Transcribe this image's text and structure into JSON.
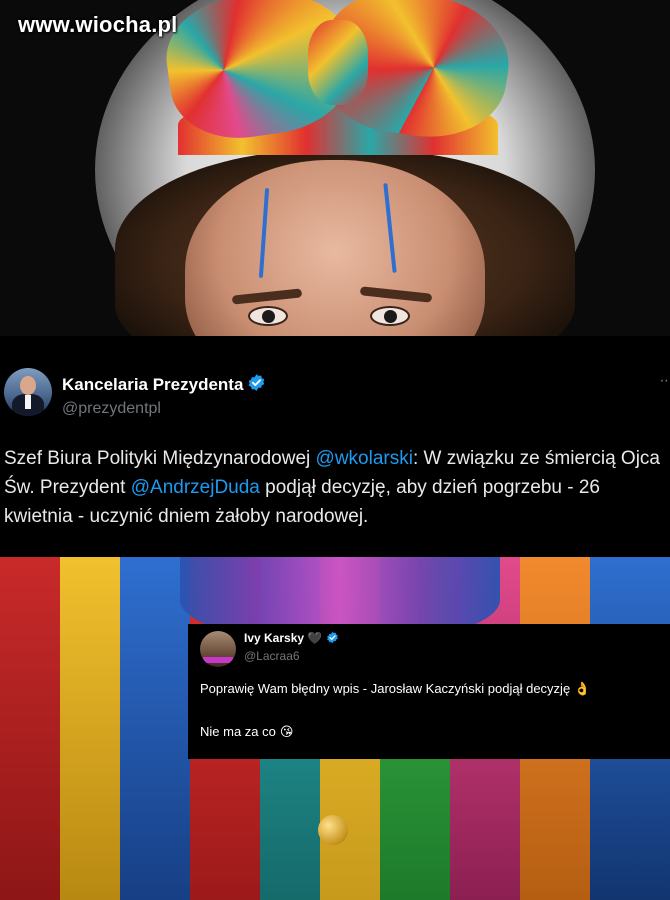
{
  "watermark": "www.wiocha.pl",
  "tweet": {
    "name": "Kancelaria Prezydenta",
    "handle": "@prezydentpl",
    "more_icon": "ellipsis-icon",
    "text_part1": "Szef Biura Polityki Międzynarodowej ",
    "mention1": "@wkolarski",
    "text_part2": ": W związku ze śmiercią Ojca Św. Prezydent ",
    "mention2": "@AndrzejDuda",
    "text_part3": " podjął decyzję, aby dzień pogrzebu - 26 kwietnia - uczynić dniem żałoby narodowej.",
    "mention_color": "#1d9bf0",
    "verified_color": "#1d9bf0"
  },
  "reply": {
    "name": "Ivy Karsky",
    "heart": "🖤",
    "handle": "@Lacraa6",
    "line1": "Poprawię Wam błędny wpis - Jarosław Kaczyński podjął decyzję",
    "line1_emoji": "👌",
    "line2": "Nie ma za co",
    "line2_emoji": "😘"
  },
  "colors": {
    "background": "#000000",
    "text": "#e7e9ea",
    "secondary_text": "#71767b"
  }
}
